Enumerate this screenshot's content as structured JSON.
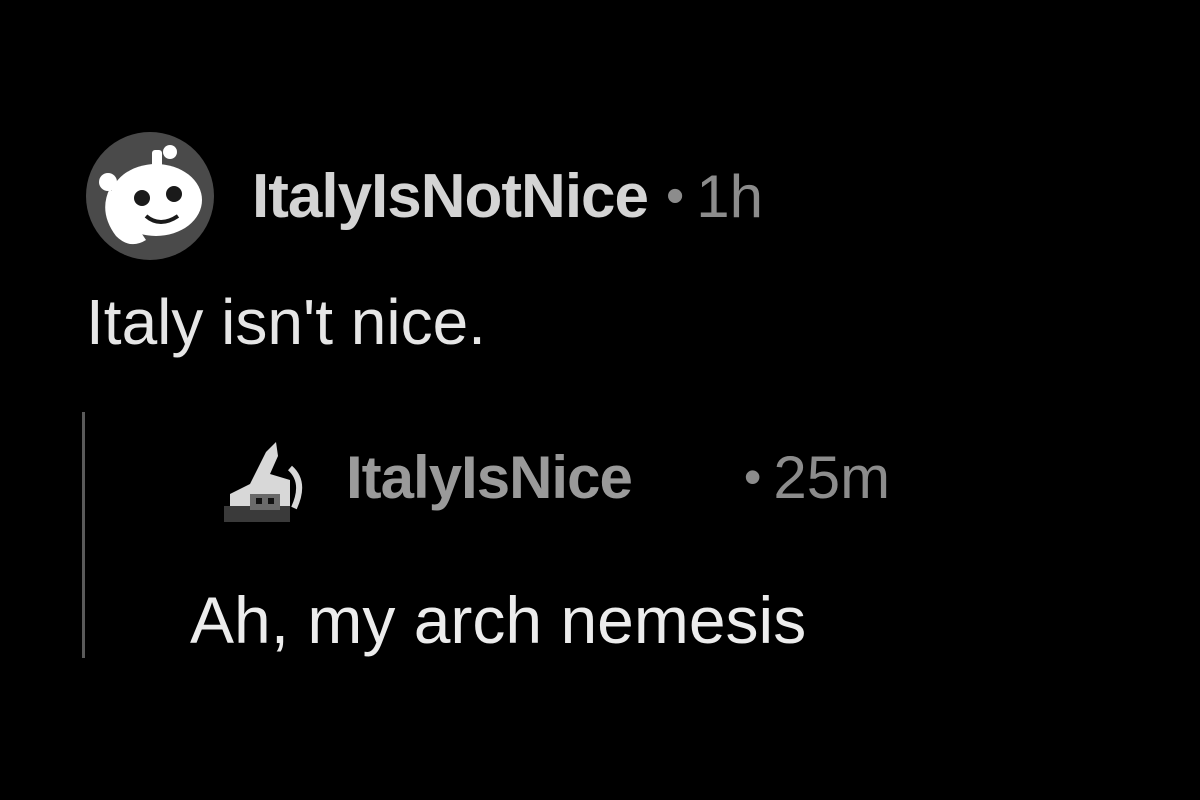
{
  "parent_comment": {
    "avatar_icon": "snoo-avatar-icon",
    "username": "ItalyIsNotNice",
    "separator": "•",
    "timestamp": "1h",
    "body": "Italy isn't nice."
  },
  "reply_comment": {
    "avatar_icon": "pixel-avatar-icon",
    "username": "ItalyIsNice",
    "separator": "•",
    "timestamp": "25m",
    "body": "Ah, my arch nemesis"
  },
  "colors": {
    "background": "#000000",
    "username": "#d4d4d4",
    "reply_username": "#9a9a9a",
    "meta": "#8c8c8c",
    "body_text": "#e6e6e6",
    "thread_line": "#5a5a5a"
  }
}
